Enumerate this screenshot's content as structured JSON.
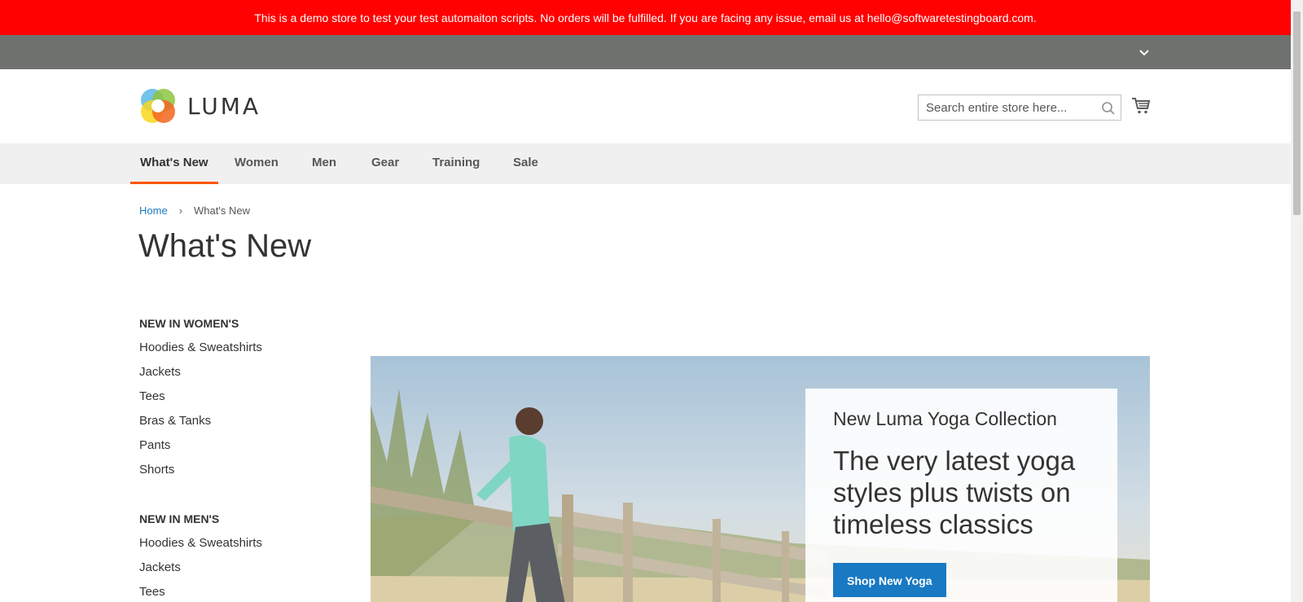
{
  "demo_banner": {
    "text": "This is a demo store to test your test automaiton scripts. No orders will be fulfilled. If you are facing any issue, email us at hello@softwaretestingboard.com."
  },
  "header": {
    "logo_text": "LUMA",
    "search_placeholder": "Search entire store here...",
    "icons": [
      "search-icon",
      "cart-icon",
      "chevron-down-icon"
    ]
  },
  "nav": {
    "items": [
      {
        "label": "What's New",
        "active": true
      },
      {
        "label": "Women"
      },
      {
        "label": "Men"
      },
      {
        "label": "Gear"
      },
      {
        "label": "Training"
      },
      {
        "label": "Sale"
      }
    ]
  },
  "breadcrumb": {
    "home": "Home",
    "separator": "›",
    "current": "What's New"
  },
  "page": {
    "title": "What's New"
  },
  "sidebar": {
    "sections": [
      {
        "heading": "New in women's",
        "links": [
          "Hoodies & Sweatshirts",
          "Jackets",
          "Tees",
          "Bras & Tanks",
          "Pants",
          "Shorts"
        ]
      },
      {
        "heading": "New in men's",
        "links": [
          "Hoodies & Sweatshirts",
          "Jackets",
          "Tees"
        ]
      }
    ]
  },
  "hero": {
    "kicker": "New Luma Yoga Collection",
    "headline": "The very latest yoga styles plus twists on timeless classics",
    "button_label": "Shop New Yoga"
  },
  "colors": {
    "banner": "#ff0101",
    "panel": "#6e716e",
    "nav_bg": "#f0f0f0",
    "nav_active_underline": "#ff5501",
    "link": "#1979c3",
    "primary_button": "#1979c3"
  }
}
